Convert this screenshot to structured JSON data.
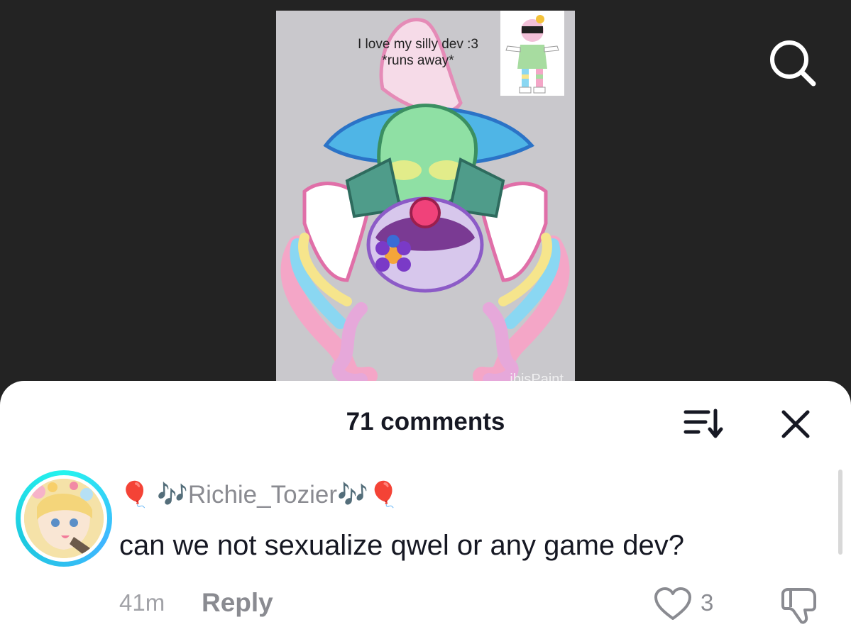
{
  "post": {
    "caption_line1": "I love my silly dev :3",
    "caption_line2": "*runs away*",
    "watermark": "ibisPaint"
  },
  "header": {
    "search_icon": "search-icon"
  },
  "comments_sheet": {
    "title": "71 comments",
    "sort_icon": "sort-icon",
    "close_icon": "close-icon"
  },
  "comment": {
    "username_prefix": "🎈 🎶",
    "username": "Richie_Tozier",
    "username_suffix": "🎶🎈",
    "text": "can we not sexualize qwel or any game dev?",
    "time": "41m",
    "reply_label": "Reply",
    "like_count": "3",
    "avatar_ring_color": "#25f4ee"
  },
  "colors": {
    "background": "#232323",
    "sheet": "#ffffff",
    "primary_text": "#161823",
    "secondary_text": "#8a8b91"
  }
}
